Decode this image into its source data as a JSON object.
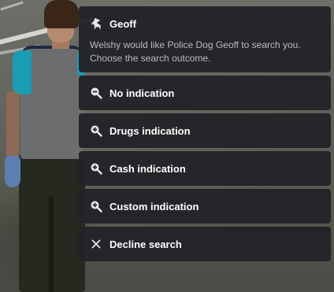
{
  "menu": {
    "header": {
      "icon": "dog-icon",
      "title": "Geoff",
      "description": "Welshy would like Police Dog Geoff to search you. Choose the search outcome."
    },
    "options": [
      {
        "icon": "zoom-out-icon",
        "label": "No indication"
      },
      {
        "icon": "zoom-in-icon",
        "label": "Drugs indication"
      },
      {
        "icon": "zoom-in-icon",
        "label": "Cash indication"
      },
      {
        "icon": "zoom-in-icon",
        "label": "Custom indication"
      },
      {
        "icon": "close-icon",
        "label": "Decline search"
      }
    ]
  },
  "colors": {
    "card_background": "#222328",
    "text_primary": "#ffffff",
    "text_secondary": "#b9bbc2",
    "icon": "#e8e8ea"
  }
}
